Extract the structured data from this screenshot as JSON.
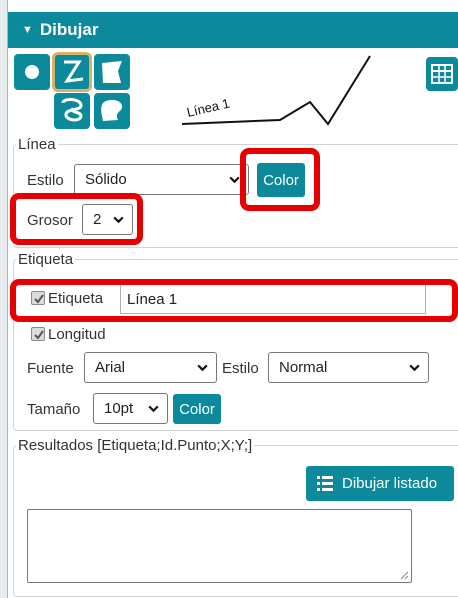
{
  "header": {
    "title": "Dibujar",
    "collapse_icon": "triangle-down-icon"
  },
  "tools": [
    "point-icon",
    "polyline-icon",
    "polygon-icon",
    "freehand-shape-icon",
    "freehand-polygon-icon"
  ],
  "canvas": {
    "sample_label": "Línea 1"
  },
  "table_icon": "table-icon",
  "linea": {
    "legend": "Línea",
    "estilo_label": "Estilo",
    "estilo_value": "Sólido",
    "color_button": "Color",
    "grosor_label": "Grosor",
    "grosor_value": "2"
  },
  "etiqueta": {
    "legend": "Etiqueta",
    "etiqueta_checkbox_label": "Etiqueta",
    "etiqueta_checked": true,
    "etiqueta_value": "Línea 1",
    "longitud_checkbox_label": "Longitud",
    "longitud_checked": true,
    "fuente_label": "Fuente",
    "fuente_value": "Arial",
    "estilo_label": "Estilo",
    "estilo_value": "Normal",
    "tamano_label": "Tamaño",
    "tamano_value": "10pt",
    "color_button": "Color"
  },
  "resultados": {
    "legend": "Resultados [Etiqueta;Id.Punto;X;Y;]",
    "dibujar_button": "Dibujar listado",
    "dibujar_icon": "list-icon",
    "textarea_value": ""
  },
  "highlight_color": "#e60000",
  "accent_color": "#0c8a9c"
}
